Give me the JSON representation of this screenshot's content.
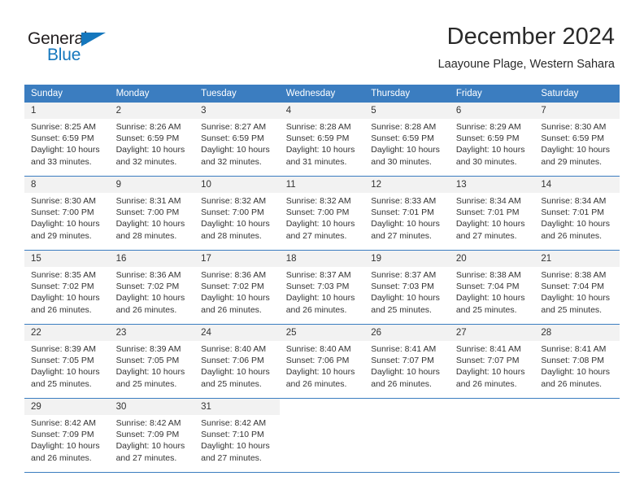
{
  "brand": {
    "name_top": "General",
    "name_bottom": "Blue",
    "flag_icon": "triangle-flag-icon",
    "accent_color": "#1577bd"
  },
  "header": {
    "month_title": "December 2024",
    "location": "Laayoune Plage, Western Sahara",
    "header_bg_color": "#3b7dc0",
    "cell_header_bg_color": "#f2f2f2"
  },
  "calendar": {
    "weekday_headers": [
      "Sunday",
      "Monday",
      "Tuesday",
      "Wednesday",
      "Thursday",
      "Friday",
      "Saturday"
    ],
    "weeks": [
      [
        {
          "day": "1",
          "sunrise": "Sunrise: 8:25 AM",
          "sunset": "Sunset: 6:59 PM",
          "daylight1": "Daylight: 10 hours",
          "daylight2": "and 33 minutes."
        },
        {
          "day": "2",
          "sunrise": "Sunrise: 8:26 AM",
          "sunset": "Sunset: 6:59 PM",
          "daylight1": "Daylight: 10 hours",
          "daylight2": "and 32 minutes."
        },
        {
          "day": "3",
          "sunrise": "Sunrise: 8:27 AM",
          "sunset": "Sunset: 6:59 PM",
          "daylight1": "Daylight: 10 hours",
          "daylight2": "and 32 minutes."
        },
        {
          "day": "4",
          "sunrise": "Sunrise: 8:28 AM",
          "sunset": "Sunset: 6:59 PM",
          "daylight1": "Daylight: 10 hours",
          "daylight2": "and 31 minutes."
        },
        {
          "day": "5",
          "sunrise": "Sunrise: 8:28 AM",
          "sunset": "Sunset: 6:59 PM",
          "daylight1": "Daylight: 10 hours",
          "daylight2": "and 30 minutes."
        },
        {
          "day": "6",
          "sunrise": "Sunrise: 8:29 AM",
          "sunset": "Sunset: 6:59 PM",
          "daylight1": "Daylight: 10 hours",
          "daylight2": "and 30 minutes."
        },
        {
          "day": "7",
          "sunrise": "Sunrise: 8:30 AM",
          "sunset": "Sunset: 6:59 PM",
          "daylight1": "Daylight: 10 hours",
          "daylight2": "and 29 minutes."
        }
      ],
      [
        {
          "day": "8",
          "sunrise": "Sunrise: 8:30 AM",
          "sunset": "Sunset: 7:00 PM",
          "daylight1": "Daylight: 10 hours",
          "daylight2": "and 29 minutes."
        },
        {
          "day": "9",
          "sunrise": "Sunrise: 8:31 AM",
          "sunset": "Sunset: 7:00 PM",
          "daylight1": "Daylight: 10 hours",
          "daylight2": "and 28 minutes."
        },
        {
          "day": "10",
          "sunrise": "Sunrise: 8:32 AM",
          "sunset": "Sunset: 7:00 PM",
          "daylight1": "Daylight: 10 hours",
          "daylight2": "and 28 minutes."
        },
        {
          "day": "11",
          "sunrise": "Sunrise: 8:32 AM",
          "sunset": "Sunset: 7:00 PM",
          "daylight1": "Daylight: 10 hours",
          "daylight2": "and 27 minutes."
        },
        {
          "day": "12",
          "sunrise": "Sunrise: 8:33 AM",
          "sunset": "Sunset: 7:01 PM",
          "daylight1": "Daylight: 10 hours",
          "daylight2": "and 27 minutes."
        },
        {
          "day": "13",
          "sunrise": "Sunrise: 8:34 AM",
          "sunset": "Sunset: 7:01 PM",
          "daylight1": "Daylight: 10 hours",
          "daylight2": "and 27 minutes."
        },
        {
          "day": "14",
          "sunrise": "Sunrise: 8:34 AM",
          "sunset": "Sunset: 7:01 PM",
          "daylight1": "Daylight: 10 hours",
          "daylight2": "and 26 minutes."
        }
      ],
      [
        {
          "day": "15",
          "sunrise": "Sunrise: 8:35 AM",
          "sunset": "Sunset: 7:02 PM",
          "daylight1": "Daylight: 10 hours",
          "daylight2": "and 26 minutes."
        },
        {
          "day": "16",
          "sunrise": "Sunrise: 8:36 AM",
          "sunset": "Sunset: 7:02 PM",
          "daylight1": "Daylight: 10 hours",
          "daylight2": "and 26 minutes."
        },
        {
          "day": "17",
          "sunrise": "Sunrise: 8:36 AM",
          "sunset": "Sunset: 7:02 PM",
          "daylight1": "Daylight: 10 hours",
          "daylight2": "and 26 minutes."
        },
        {
          "day": "18",
          "sunrise": "Sunrise: 8:37 AM",
          "sunset": "Sunset: 7:03 PM",
          "daylight1": "Daylight: 10 hours",
          "daylight2": "and 26 minutes."
        },
        {
          "day": "19",
          "sunrise": "Sunrise: 8:37 AM",
          "sunset": "Sunset: 7:03 PM",
          "daylight1": "Daylight: 10 hours",
          "daylight2": "and 25 minutes."
        },
        {
          "day": "20",
          "sunrise": "Sunrise: 8:38 AM",
          "sunset": "Sunset: 7:04 PM",
          "daylight1": "Daylight: 10 hours",
          "daylight2": "and 25 minutes."
        },
        {
          "day": "21",
          "sunrise": "Sunrise: 8:38 AM",
          "sunset": "Sunset: 7:04 PM",
          "daylight1": "Daylight: 10 hours",
          "daylight2": "and 25 minutes."
        }
      ],
      [
        {
          "day": "22",
          "sunrise": "Sunrise: 8:39 AM",
          "sunset": "Sunset: 7:05 PM",
          "daylight1": "Daylight: 10 hours",
          "daylight2": "and 25 minutes."
        },
        {
          "day": "23",
          "sunrise": "Sunrise: 8:39 AM",
          "sunset": "Sunset: 7:05 PM",
          "daylight1": "Daylight: 10 hours",
          "daylight2": "and 25 minutes."
        },
        {
          "day": "24",
          "sunrise": "Sunrise: 8:40 AM",
          "sunset": "Sunset: 7:06 PM",
          "daylight1": "Daylight: 10 hours",
          "daylight2": "and 25 minutes."
        },
        {
          "day": "25",
          "sunrise": "Sunrise: 8:40 AM",
          "sunset": "Sunset: 7:06 PM",
          "daylight1": "Daylight: 10 hours",
          "daylight2": "and 26 minutes."
        },
        {
          "day": "26",
          "sunrise": "Sunrise: 8:41 AM",
          "sunset": "Sunset: 7:07 PM",
          "daylight1": "Daylight: 10 hours",
          "daylight2": "and 26 minutes."
        },
        {
          "day": "27",
          "sunrise": "Sunrise: 8:41 AM",
          "sunset": "Sunset: 7:07 PM",
          "daylight1": "Daylight: 10 hours",
          "daylight2": "and 26 minutes."
        },
        {
          "day": "28",
          "sunrise": "Sunrise: 8:41 AM",
          "sunset": "Sunset: 7:08 PM",
          "daylight1": "Daylight: 10 hours",
          "daylight2": "and 26 minutes."
        }
      ],
      [
        {
          "day": "29",
          "sunrise": "Sunrise: 8:42 AM",
          "sunset": "Sunset: 7:09 PM",
          "daylight1": "Daylight: 10 hours",
          "daylight2": "and 26 minutes."
        },
        {
          "day": "30",
          "sunrise": "Sunrise: 8:42 AM",
          "sunset": "Sunset: 7:09 PM",
          "daylight1": "Daylight: 10 hours",
          "daylight2": "and 27 minutes."
        },
        {
          "day": "31",
          "sunrise": "Sunrise: 8:42 AM",
          "sunset": "Sunset: 7:10 PM",
          "daylight1": "Daylight: 10 hours",
          "daylight2": "and 27 minutes."
        },
        null,
        null,
        null,
        null
      ]
    ]
  }
}
